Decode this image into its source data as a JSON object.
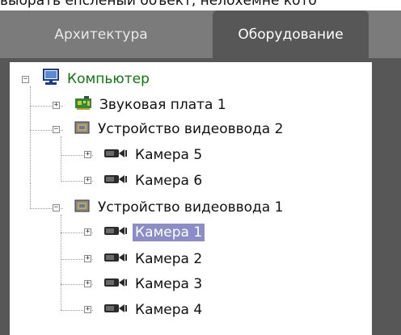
{
  "caption": "выбрать enсленый объект, нелохемне кото",
  "tabs": [
    {
      "label": "Архитектура",
      "active": false
    },
    {
      "label": "Оборудование",
      "active": true
    }
  ],
  "tree": {
    "root": {
      "label": "Компьютер",
      "expander": "−"
    },
    "sound_card": {
      "label": "Звуковая плата 1",
      "expander": "+"
    },
    "video_device_2": {
      "label": "Устройство видеоввода 2",
      "expander": "−"
    },
    "camera_5": {
      "label": "Камера 5",
      "expander": "+"
    },
    "camera_6": {
      "label": "Камера 6",
      "expander": "+"
    },
    "video_device_1": {
      "label": "Устройство видеоввода 1",
      "expander": "−"
    },
    "camera_1": {
      "label": "Камера 1",
      "expander": "+",
      "selected": true
    },
    "camera_2": {
      "label": "Камера 2",
      "expander": "+"
    },
    "camera_3": {
      "label": "Камера 3",
      "expander": "+"
    },
    "camera_4": {
      "label": "Камера 4",
      "expander": "+"
    }
  },
  "colors": {
    "tab_bar": "#7b7b7b",
    "tab_active": "#575757",
    "selection": "#8c8cc8",
    "root_label": "#0a7a0a"
  },
  "icons": {
    "root": "computer-icon",
    "sound_card": "sound-card-icon",
    "video_device": "video-capture-device-icon",
    "camera": "camera-icon"
  }
}
